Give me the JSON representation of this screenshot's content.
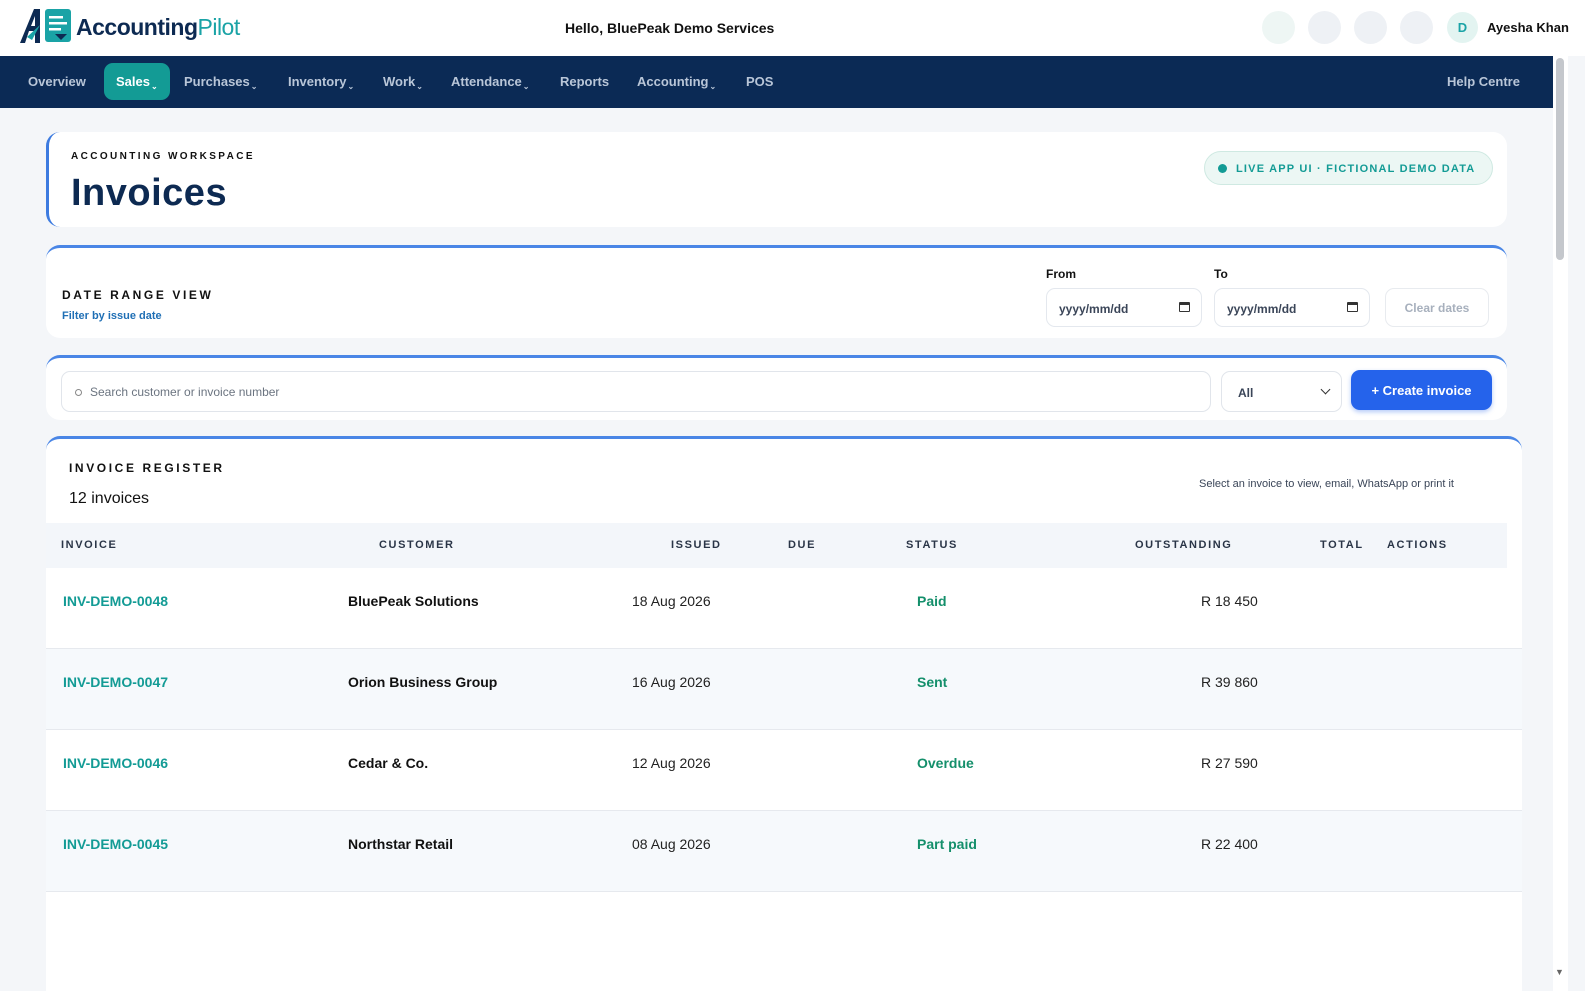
{
  "header": {
    "logo_main": "Accounting",
    "logo_accent": "Pilot",
    "greeting": "Hello, BluePeak Demo Services",
    "avatar_initial": "D",
    "user_name": "Ayesha Khan"
  },
  "nav": {
    "items": [
      {
        "label": "Overview",
        "caret": ""
      },
      {
        "label": "Sales",
        "caret": "⌄"
      },
      {
        "label": "Purchases",
        "caret": "⌄"
      },
      {
        "label": "Inventory",
        "caret": "⌄"
      },
      {
        "label": "Work",
        "caret": "⌄"
      },
      {
        "label": "Attendance",
        "caret": "⌄"
      },
      {
        "label": "Reports",
        "caret": ""
      },
      {
        "label": "Accounting",
        "caret": "⌄"
      },
      {
        "label": "POS",
        "caret": ""
      }
    ],
    "active": "Sales",
    "help": "Help Centre"
  },
  "title_card": {
    "eyebrow": "ACCOUNTING WORKSPACE",
    "title": "Invoices",
    "badge": "LIVE APP UI · FICTIONAL DEMO DATA"
  },
  "date_range": {
    "heading": "DATE RANGE VIEW",
    "subheading": "Filter by issue date",
    "from_label": "From",
    "to_label": "To",
    "from_placeholder": "yyyy/mm/dd",
    "to_placeholder": "yyyy/mm/dd",
    "clear_label": "Clear dates"
  },
  "search": {
    "placeholder": "Search customer or invoice number",
    "filter_value": "All",
    "create_label": "+ Create invoice"
  },
  "register": {
    "heading": "INVOICE REGISTER",
    "count": "12 invoices",
    "hint": "Select an invoice to view, email, WhatsApp or print it",
    "columns": [
      "INVOICE",
      "CUSTOMER",
      "ISSUED",
      "DUE",
      "STATUS",
      "OUTSTANDING",
      "TOTAL",
      "ACTIONS"
    ],
    "rows": [
      {
        "invoice": "INV-DEMO-0048",
        "customer": "BluePeak Solutions",
        "issued": "18 Aug 2026",
        "status": "Paid",
        "outstanding": "R 18 450"
      },
      {
        "invoice": "INV-DEMO-0047",
        "customer": "Orion Business Group",
        "issued": "16 Aug 2026",
        "status": "Sent",
        "outstanding": "R 39 860"
      },
      {
        "invoice": "INV-DEMO-0046",
        "customer": "Cedar & Co.",
        "issued": "12 Aug 2026",
        "status": "Overdue",
        "outstanding": "R 27 590"
      },
      {
        "invoice": "INV-DEMO-0045",
        "customer": "Northstar Retail",
        "issued": "08 Aug 2026",
        "status": "Part paid",
        "outstanding": "R 22 400"
      }
    ]
  },
  "colors": {
    "nav_bg": "#0b2a55",
    "accent_teal": "#139b95",
    "primary_blue": "#2563eb",
    "status_green": "#148f6b"
  }
}
